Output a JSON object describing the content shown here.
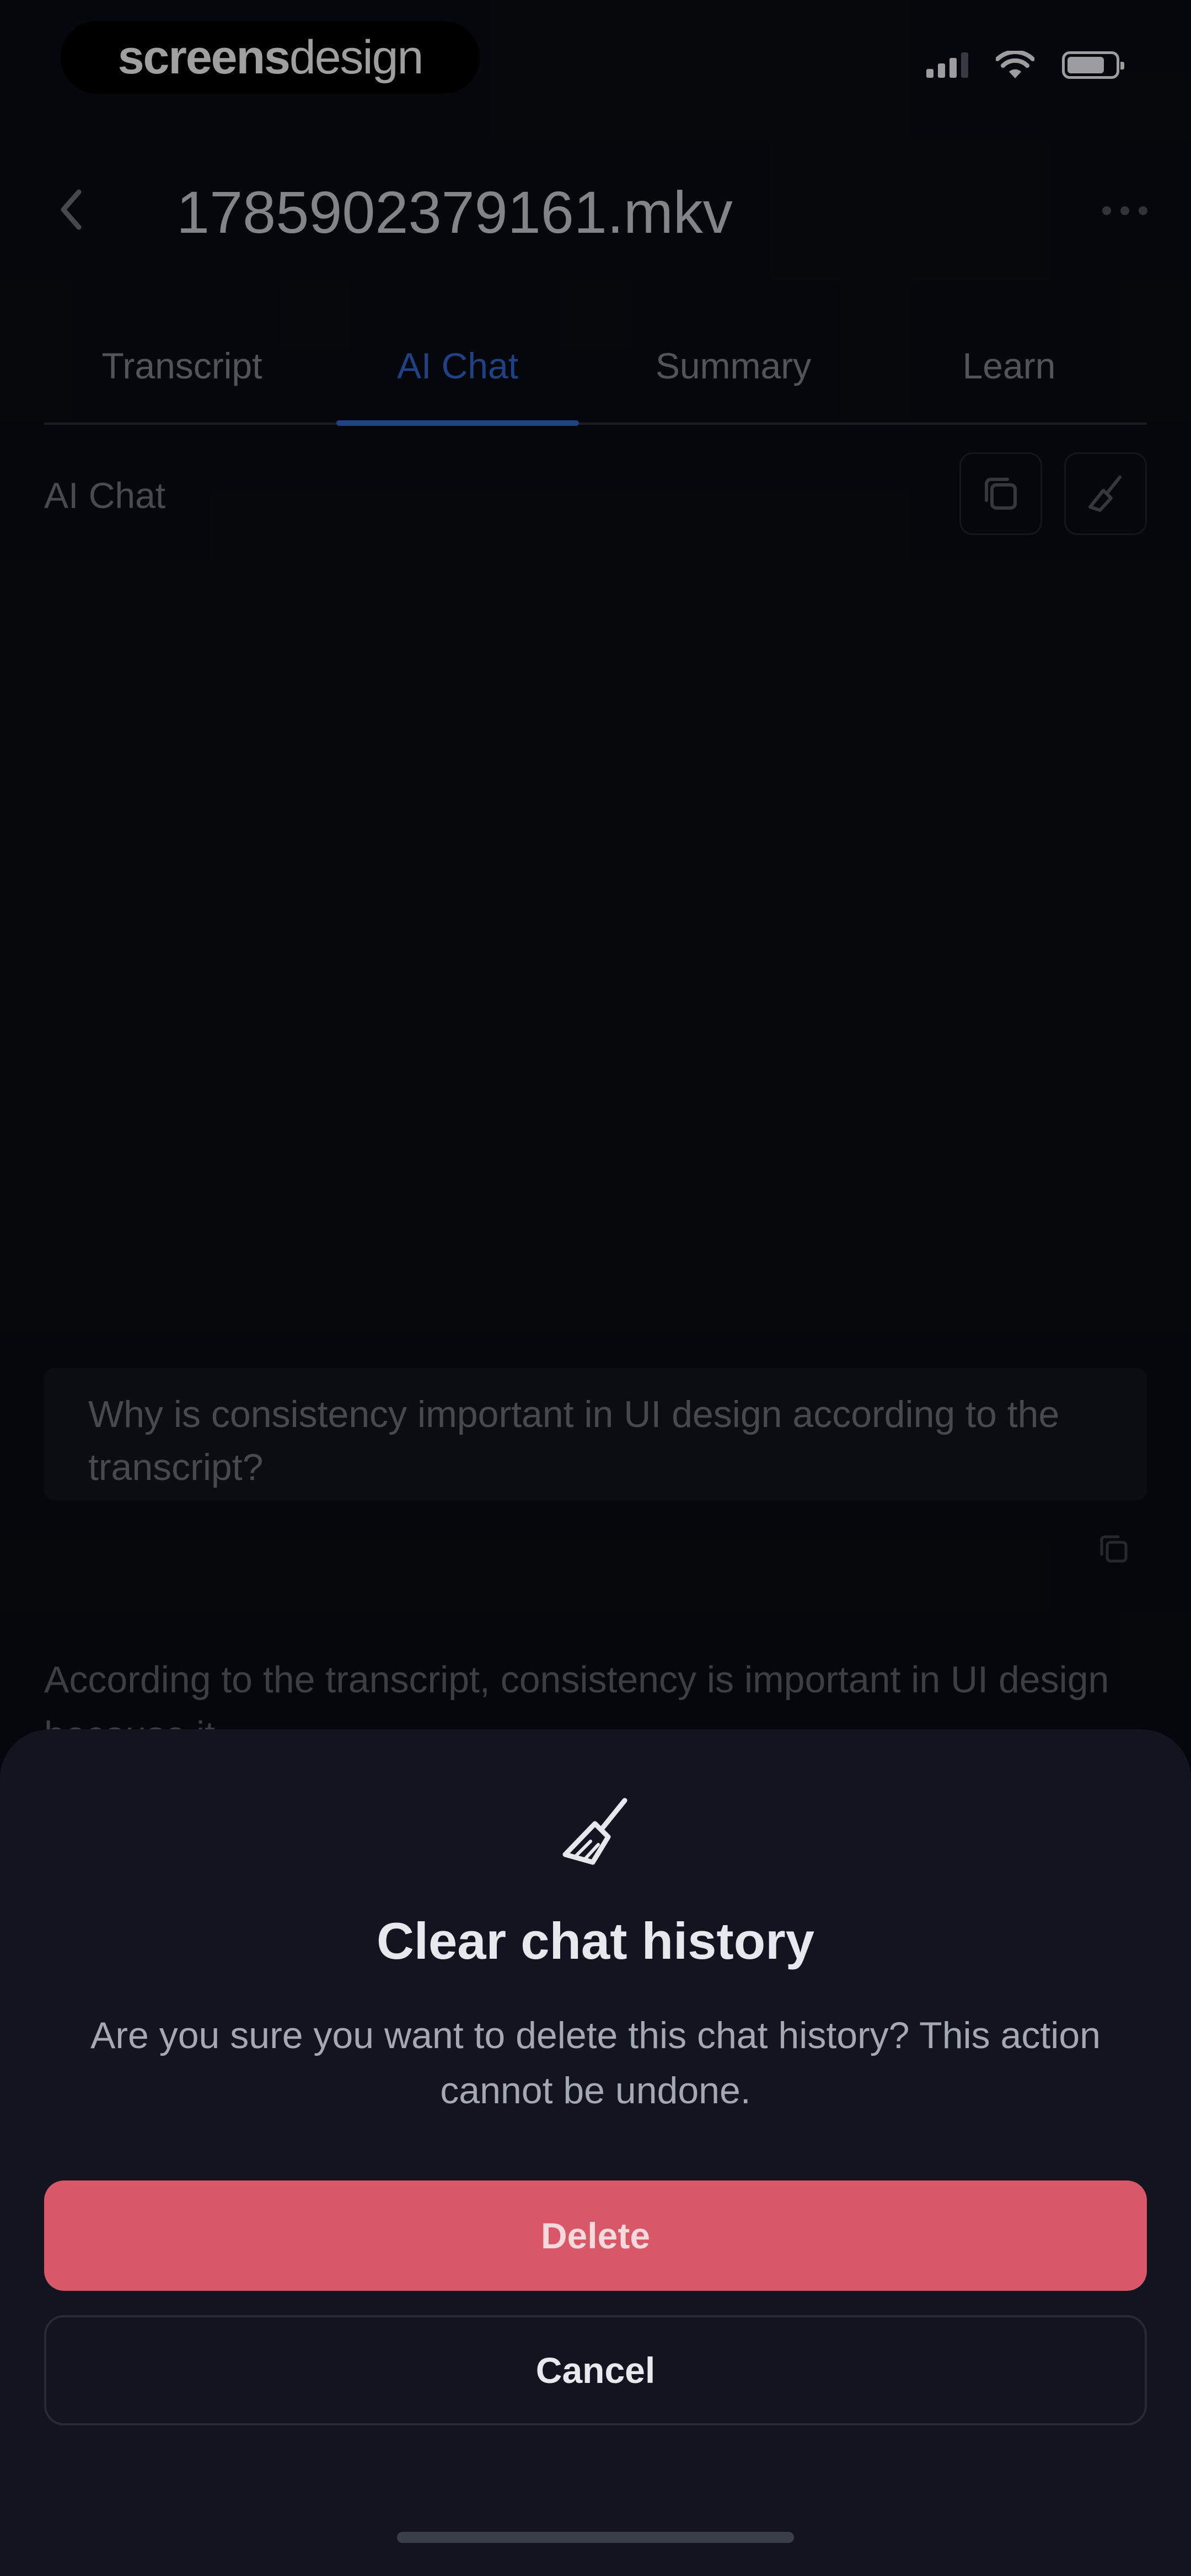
{
  "status_bar": {
    "brand_bold": "screens",
    "brand_light": "design"
  },
  "header": {
    "title": "1785902379161.mkv",
    "back_icon": "chevron-left-icon",
    "more_icon": "ellipsis-icon"
  },
  "tabs": [
    {
      "label": "Transcript",
      "active": false
    },
    {
      "label": "AI Chat",
      "active": true
    },
    {
      "label": "Summary",
      "active": false
    },
    {
      "label": "Learn",
      "active": false
    }
  ],
  "section": {
    "label": "AI Chat",
    "copy_icon": "copy-icon",
    "clear_icon": "broom-icon"
  },
  "chat": {
    "user_message": "Why is consistency important in UI design according to the transcript?",
    "assistant_reply": "According to the transcript, consistency is important in UI design because it..."
  },
  "dialog": {
    "icon": "broom-icon",
    "title": "Clear chat history",
    "message": "Are you sure you want to delete this chat history? This action cannot be undone.",
    "delete_label": "Delete",
    "cancel_label": "Cancel"
  },
  "colors": {
    "accent": "#2f66c9",
    "danger": "#d95868",
    "background": "#0a0c13",
    "sheet": "#121520"
  }
}
